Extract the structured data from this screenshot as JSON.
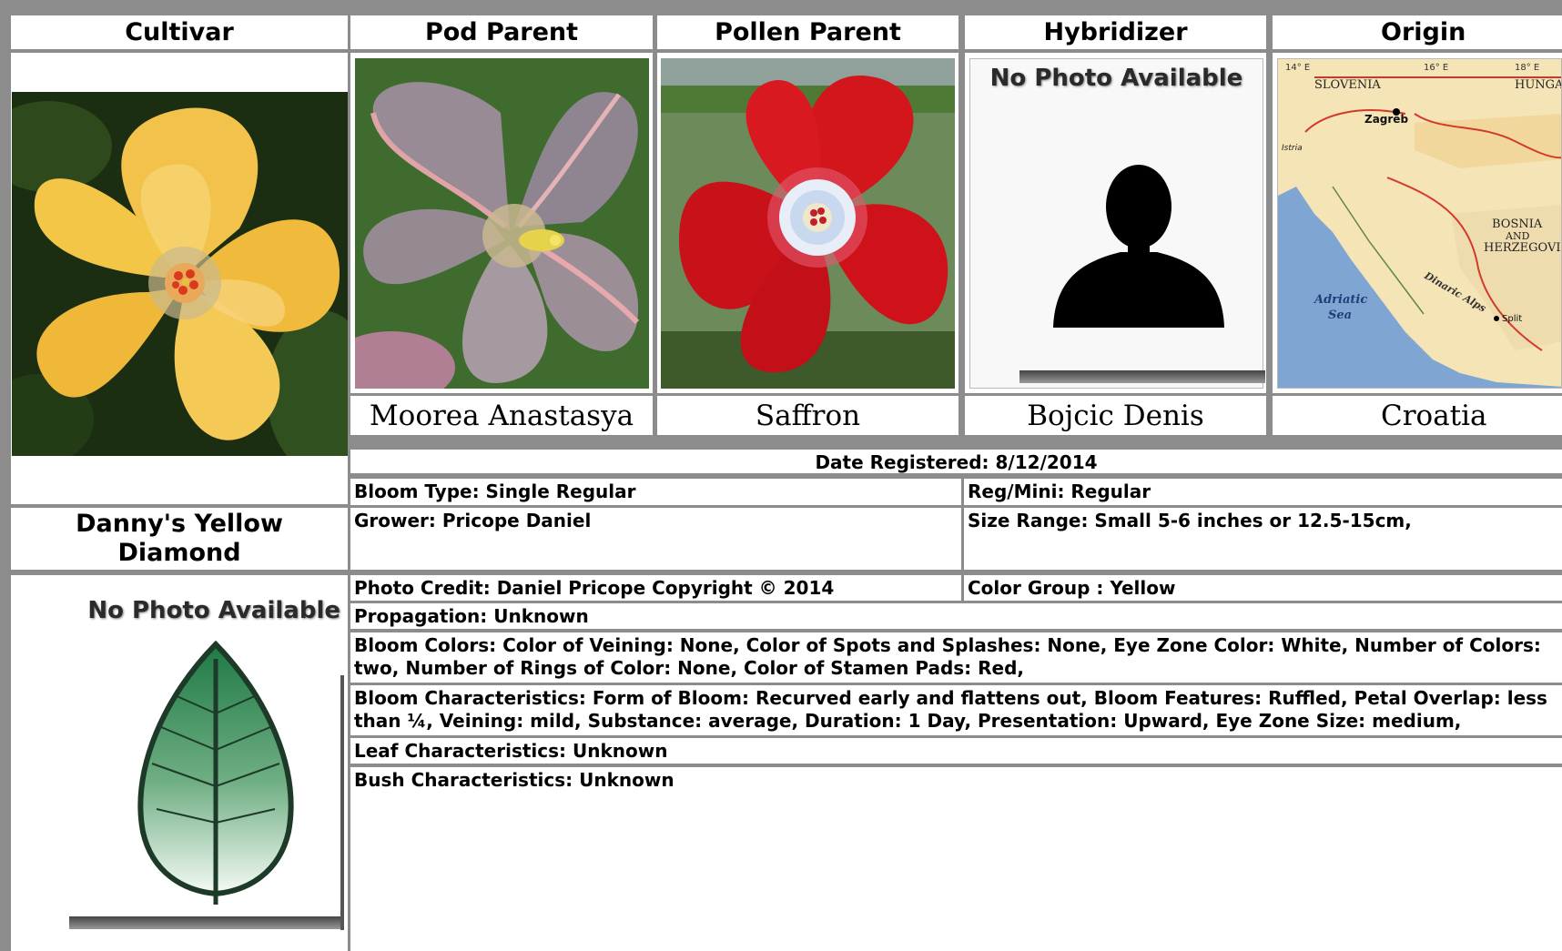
{
  "headers": {
    "cultivar": "Cultivar",
    "pod_parent": "Pod Parent",
    "pollen_parent": "Pollen Parent",
    "hybridizer": "Hybridizer",
    "origin": "Origin"
  },
  "parents": {
    "pod_parent_name": "Moorea Anastasya",
    "pollen_parent_name": "Saffron",
    "hybridizer_name": "Bojcic Denis",
    "origin_name": "Croatia"
  },
  "cultivar_name": "Danny's Yellow Diamond",
  "placeholders": {
    "no_photo": "No Photo Available"
  },
  "map_labels": {
    "slovenia": "SLOVENIA",
    "hungary": "HUNGAR",
    "zagreb": "Zagreb",
    "bosnia": "BOSNIA",
    "and": "AND",
    "herzegovina": "HERZEGOVINA",
    "adriatic": "Adriatic",
    "sea": "Sea",
    "istria": "Istria",
    "split": "Split",
    "dinaric_alps": "Dinaric Alps",
    "lon_14": "14° E",
    "lon_16": "16° E",
    "lon_18": "18° E"
  },
  "details": {
    "date_registered": "Date Registered:  8/12/2014",
    "bloom_type": "Bloom Type: Single Regular",
    "reg_mini": "Reg/Mini: Regular",
    "grower": "Grower: Pricope Daniel",
    "size_range": "Size Range: Small 5-6 inches or 12.5-15cm,",
    "photo_credit": "Photo Credit: Daniel Pricope Copyright © 2014",
    "color_group": "Color Group : Yellow",
    "propagation": "Propagation: Unknown",
    "bloom_colors": "Bloom Colors: Color of Veining: None, Color of Spots and Splashes: None, Eye Zone Color: White, Number of Colors: two, Number of Rings of Color: None, Color of Stamen Pads: Red,",
    "bloom_characteristics": "Bloom Characteristics: Form of Bloom: Recurved early and flattens out, Bloom Features: Ruffled, Petal Overlap: less than ¼, Veining: mild, Substance: average, Duration: 1 Day, Presentation: Upward, Eye Zone Size: medium,",
    "leaf_characteristics": "Leaf Characteristics: Unknown",
    "bush_characteristics": "Bush Characteristics: Unknown"
  },
  "colors": {
    "frame_gray": "#8c8c8c",
    "yellow_bloom": "#f2c33a",
    "red_bloom": "#d3141a",
    "lavender_bloom": "#9c8f98",
    "leaf_green": "#2f8a4c"
  },
  "icons": {
    "person_silhouette": "person-silhouette-icon",
    "leaf": "leaf-icon"
  }
}
